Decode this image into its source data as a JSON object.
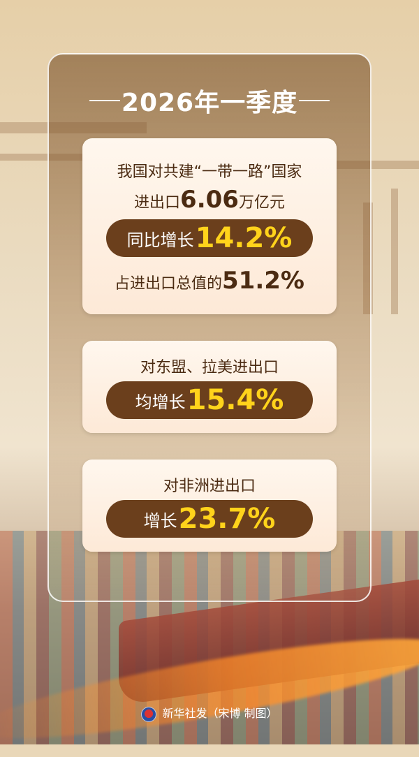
{
  "title": "2026年一季度",
  "cards": {
    "card1": {
      "line1": "我国对共建“一带一路”国家",
      "line2_prefix": "进出口",
      "line2_value": "6.06",
      "line2_suffix": "万亿元",
      "pill_prefix": "同比增长",
      "pill_value": "14.2%",
      "line4_prefix": "占进出口总值的",
      "line4_value": "51.2%"
    },
    "card2": {
      "line1": "对东盟、拉美进出口",
      "pill_prefix": "均增长",
      "pill_value": "15.4%"
    },
    "card3": {
      "line1": "对非洲进出口",
      "pill_prefix": "增长",
      "pill_value": "23.7%"
    }
  },
  "footer": {
    "text": "新华社发（宋博 制图）",
    "logo_icon": "xinhua-logo-icon"
  },
  "colors": {
    "pill_background": "#6b3f1c",
    "highlight_yellow": "#ffd31b",
    "card_text": "#4b2b12"
  }
}
